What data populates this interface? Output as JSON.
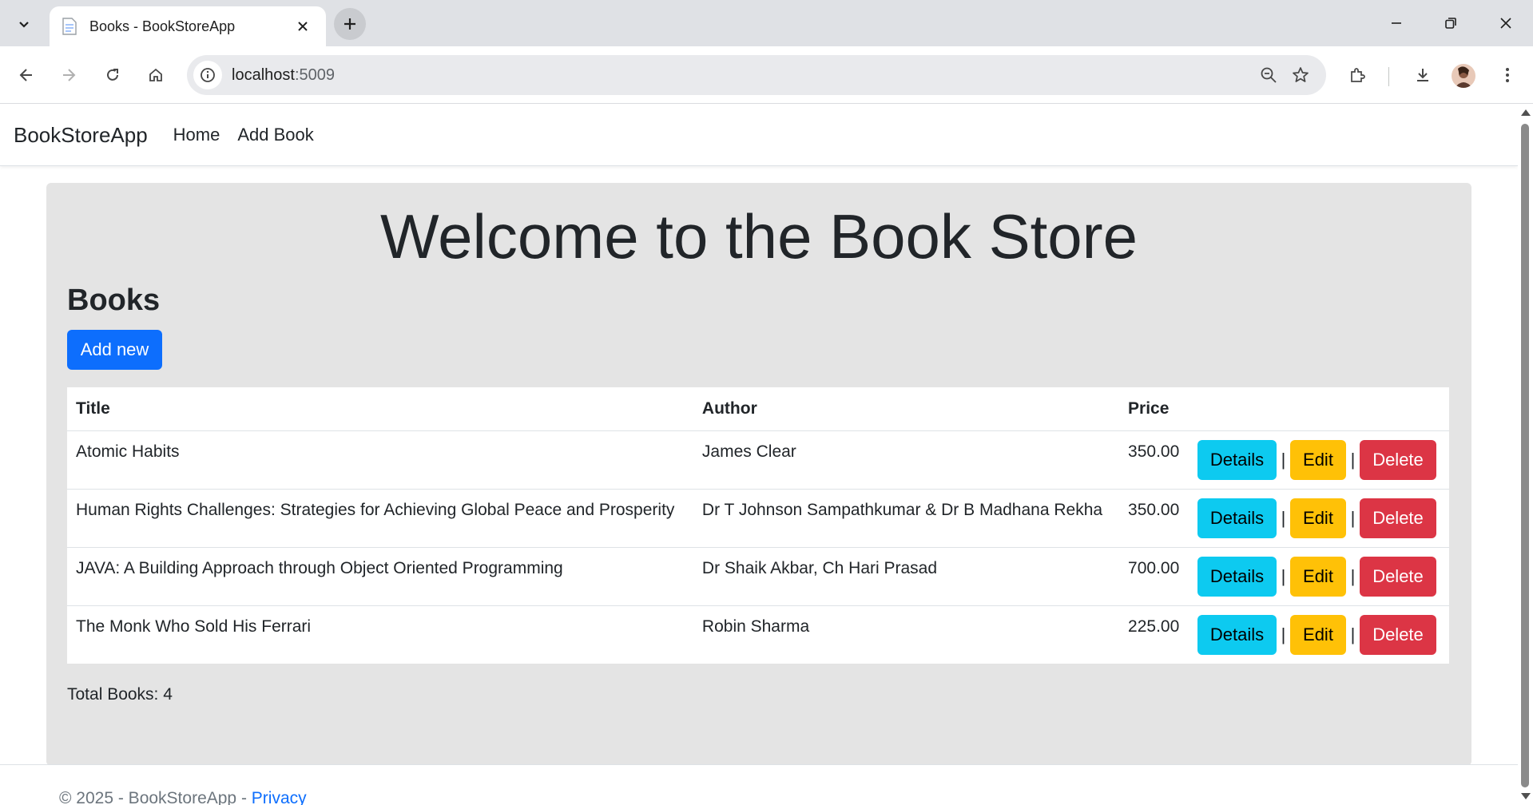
{
  "browser": {
    "tab_title": "Books - BookStoreApp",
    "url_host": "localhost",
    "url_port": ":5009"
  },
  "navbar": {
    "brand": "BookStoreApp",
    "links": [
      "Home",
      "Add Book"
    ]
  },
  "main": {
    "welcome": "Welcome to the Book Store",
    "heading": "Books",
    "add_button": "Add new",
    "table": {
      "headers": [
        "Title",
        "Author",
        "Price"
      ],
      "rows": [
        {
          "title": "Atomic Habits",
          "author": "James Clear",
          "price": "350.00"
        },
        {
          "title": "Human Rights Challenges: Strategies for Achieving Global Peace and Prosperity",
          "author": "Dr T Johnson Sampathkumar & Dr B Madhana Rekha",
          "price": "350.00"
        },
        {
          "title": "JAVA: A Building Approach through Object Oriented Programming",
          "author": "Dr Shaik Akbar, Ch Hari Prasad",
          "price": "700.00"
        },
        {
          "title": "The Monk Who Sold His Ferrari",
          "author": "Robin Sharma",
          "price": "225.00"
        }
      ],
      "actions": {
        "details": "Details",
        "edit": "Edit",
        "delete": "Delete",
        "separator": "|"
      }
    },
    "total_label": "Total Books: 4"
  },
  "footer": {
    "text": "© 2025 - BookStoreApp - ",
    "privacy_link": "Privacy"
  },
  "colors": {
    "primary": "#0d6efd",
    "info": "#0dcaf0",
    "warning": "#ffc107",
    "danger": "#dc3545",
    "jumbotron_bg": "#e4e4e4"
  },
  "icons": [
    "tab-search-icon",
    "page-favicon-icon",
    "close-icon",
    "plus-icon",
    "minimize-icon",
    "restore-icon",
    "window-close-icon",
    "back-arrow-icon",
    "forward-arrow-icon",
    "reload-icon",
    "home-icon",
    "site-info-icon",
    "zoom-icon",
    "bookmark-star-icon",
    "extensions-icon",
    "download-icon",
    "profile-avatar",
    "more-menu-icon"
  ]
}
